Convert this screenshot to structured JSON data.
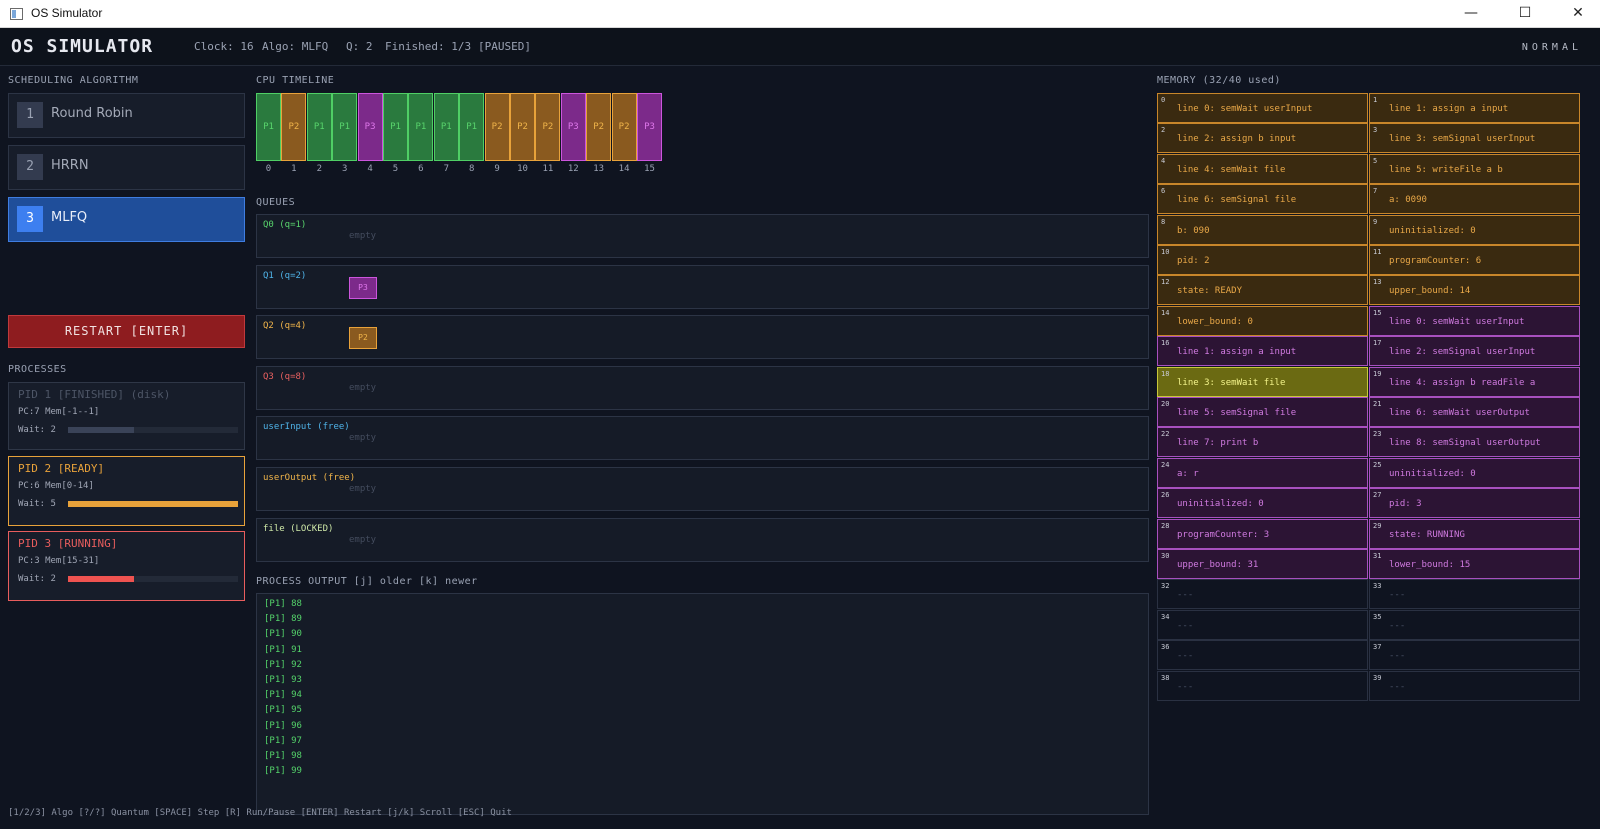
{
  "window": {
    "title": "OS Simulator",
    "minimize": "—",
    "maximize": "☐",
    "close": "✕"
  },
  "header": {
    "logo": "OS SIMULATOR",
    "clock": "Clock: 16",
    "algo": "Algo: MLFQ",
    "quantum": "Q: 2",
    "finished": "Finished: 1/3",
    "state": "[PAUSED]",
    "mode": "NORMAL"
  },
  "sections": {
    "scheduling": "SCHEDULING ALGORITHM",
    "processes": "PROCESSES",
    "timeline": "CPU TIMELINE",
    "queues": "QUEUES",
    "output": "PROCESS OUTPUT [j] older [k] newer",
    "memory": "MEMORY (32/40 used)"
  },
  "algorithms": [
    {
      "num": "1",
      "label": "Round Robin",
      "active": false
    },
    {
      "num": "2",
      "label": "HRRN",
      "active": false
    },
    {
      "num": "3",
      "label": "MLFQ",
      "active": true
    }
  ],
  "restart_label": "RESTART [ENTER]",
  "processes": [
    {
      "title": "PID 1 [FINISHED] (disk)",
      "info": "PC:7  Mem[-1--1]",
      "wait": "Wait: 2",
      "wait_fraction": 0.39,
      "color": "#4d5566",
      "bar_color": "#3a4358"
    },
    {
      "title": "PID 2 [READY]",
      "info": "PC:6  Mem[0-14]",
      "wait": "Wait: 5",
      "wait_fraction": 1.0,
      "color": "#e8a23a",
      "bar_color": "#e8a23a"
    },
    {
      "title": "PID 3 [RUNNING]",
      "info": "PC:3  Mem[15-31]",
      "wait": "Wait: 2",
      "wait_fraction": 0.39,
      "color": "#e85d5d",
      "bar_color": "#ef5350"
    }
  ],
  "timeline": {
    "cells": [
      "P1",
      "P2",
      "P1",
      "P1",
      "P3",
      "P1",
      "P1",
      "P1",
      "P1",
      "P2",
      "P2",
      "P2",
      "P3",
      "P2",
      "P2",
      "P3"
    ],
    "ticks": [
      "0",
      "1",
      "2",
      "3",
      "4",
      "5",
      "6",
      "7",
      "8",
      "9",
      "10",
      "11",
      "12",
      "13",
      "14",
      "15"
    ]
  },
  "process_colors": {
    "P1": {
      "bg": "#2a7a3e",
      "border": "#4fcf65",
      "text": "#58d46c"
    },
    "P2": {
      "bg": "#8a5a1f",
      "border": "#e8a23a",
      "text": "#f0b44a"
    },
    "P3": {
      "bg": "#7c2a8a",
      "border": "#cc55dd",
      "text": "#de77ea"
    }
  },
  "queues": [
    {
      "label": "Q0 (q=1)",
      "color": "#58d46c",
      "empty": "empty",
      "items": []
    },
    {
      "label": "Q1 (q=2)",
      "color": "#4fb3e8",
      "empty": "",
      "items": [
        "P3"
      ]
    },
    {
      "label": "Q2 (q=4)",
      "color": "#f0b44a",
      "empty": "",
      "items": [
        "P2"
      ]
    },
    {
      "label": "Q3 (q=8)",
      "color": "#e86060",
      "empty": "empty",
      "items": []
    },
    {
      "label": "userInput (free)",
      "color": "#4fb3e8",
      "empty": "empty",
      "items": []
    },
    {
      "label": "userOutput (free)",
      "color": "#f0b44a",
      "empty": "empty",
      "items": []
    },
    {
      "label": "file (LOCKED)",
      "color": "#cfe9a8",
      "empty": "empty",
      "items": []
    }
  ],
  "output_lines": [
    "[P1] 88",
    "[P1] 89",
    "[P1] 90",
    "[P1] 91",
    "[P1] 92",
    "[P1] 93",
    "[P1] 94",
    "[P1] 95",
    "[P1] 96",
    "[P1] 97",
    "[P1] 98",
    "[P1] 99"
  ],
  "footer": "[1/2/3] Algo [?/?] Quantum [SPACE] Step [R] Run/Pause [ENTER] Restart [j/k] Scroll [ESC] Quit",
  "memory": [
    {
      "i": "0",
      "v": "line 0: semWait userInput",
      "owner": "P2"
    },
    {
      "i": "1",
      "v": "line 1: assign a input",
      "owner": "P2"
    },
    {
      "i": "2",
      "v": "line 2: assign b input",
      "owner": "P2"
    },
    {
      "i": "3",
      "v": "line 3: semSignal userInput",
      "owner": "P2"
    },
    {
      "i": "4",
      "v": "line 4: semWait file",
      "owner": "P2"
    },
    {
      "i": "5",
      "v": "line 5: writeFile a b",
      "owner": "P2"
    },
    {
      "i": "6",
      "v": "line 6: semSignal file",
      "owner": "P2"
    },
    {
      "i": "7",
      "v": "a: 0090",
      "owner": "P2"
    },
    {
      "i": "8",
      "v": "b: 090",
      "owner": "P2"
    },
    {
      "i": "9",
      "v": "uninitialized: 0",
      "owner": "P2"
    },
    {
      "i": "10",
      "v": "pid: 2",
      "owner": "P2"
    },
    {
      "i": "11",
      "v": "programCounter: 6",
      "owner": "P2"
    },
    {
      "i": "12",
      "v": "state: READY",
      "owner": "P2"
    },
    {
      "i": "13",
      "v": "upper_bound: 14",
      "owner": "P2"
    },
    {
      "i": "14",
      "v": "lower_bound: 0",
      "owner": "P2"
    },
    {
      "i": "15",
      "v": "line 0: semWait userInput",
      "owner": "P3"
    },
    {
      "i": "16",
      "v": "line 1: assign a input",
      "owner": "P3"
    },
    {
      "i": "17",
      "v": "line 2: semSignal userInput",
      "owner": "P3"
    },
    {
      "i": "18",
      "v": "line 3: semWait file",
      "owner": "HL"
    },
    {
      "i": "19",
      "v": "line 4: assign b readFile a",
      "owner": "P3"
    },
    {
      "i": "20",
      "v": "line 5: semSignal file",
      "owner": "P3"
    },
    {
      "i": "21",
      "v": "line 6: semWait userOutput",
      "owner": "P3"
    },
    {
      "i": "22",
      "v": "line 7: print b",
      "owner": "P3"
    },
    {
      "i": "23",
      "v": "line 8: semSignal userOutput",
      "owner": "P3"
    },
    {
      "i": "24",
      "v": "a: r",
      "owner": "P3"
    },
    {
      "i": "25",
      "v": "uninitialized: 0",
      "owner": "P3"
    },
    {
      "i": "26",
      "v": "uninitialized: 0",
      "owner": "P3"
    },
    {
      "i": "27",
      "v": "pid: 3",
      "owner": "P3"
    },
    {
      "i": "28",
      "v": "programCounter: 3",
      "owner": "P3"
    },
    {
      "i": "29",
      "v": "state: RUNNING",
      "owner": "P3"
    },
    {
      "i": "30",
      "v": "upper_bound: 31",
      "owner": "P3"
    },
    {
      "i": "31",
      "v": "lower_bound: 15",
      "owner": "P3"
    },
    {
      "i": "32",
      "v": "---",
      "owner": "FREE"
    },
    {
      "i": "33",
      "v": "---",
      "owner": "FREE"
    },
    {
      "i": "34",
      "v": "---",
      "owner": "FREE"
    },
    {
      "i": "35",
      "v": "---",
      "owner": "FREE"
    },
    {
      "i": "36",
      "v": "---",
      "owner": "FREE"
    },
    {
      "i": "37",
      "v": "---",
      "owner": "FREE"
    },
    {
      "i": "38",
      "v": "---",
      "owner": "FREE"
    },
    {
      "i": "39",
      "v": "---",
      "owner": "FREE"
    }
  ],
  "memory_colors": {
    "P2": {
      "bg": "#3a2a10",
      "border": "#c8862a",
      "text": "#e9a848"
    },
    "P3": {
      "bg": "#2c1434",
      "border": "#a850bf",
      "text": "#d07ae0"
    },
    "HL": {
      "bg": "#6b6a12",
      "border": "#c8c83a",
      "text": "#f3f38a"
    },
    "FREE": {
      "bg": "#0f1420",
      "border": "#2a3142",
      "text": "#4b5366"
    }
  }
}
